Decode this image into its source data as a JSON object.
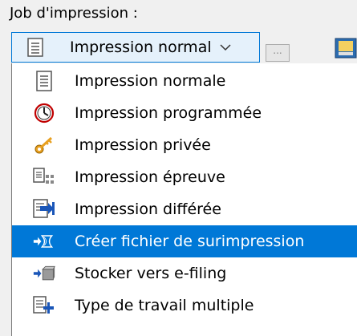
{
  "job_label": "Job d'impression :",
  "combo": {
    "selected": "Impression normal",
    "more_button": "..."
  },
  "options": [
    {
      "label": "Impression normale",
      "icon": "document-icon"
    },
    {
      "label": "Impression programmée",
      "icon": "clock-icon"
    },
    {
      "label": "Impression privée",
      "icon": "key-icon"
    },
    {
      "label": "Impression épreuve",
      "icon": "proof-icon"
    },
    {
      "label": "Impression différée",
      "icon": "hold-icon"
    },
    {
      "label": "Créer fichier de surimpression",
      "icon": "overlay-icon"
    },
    {
      "label": "Stocker vers e-filing",
      "icon": "efiling-icon"
    },
    {
      "label": "Type de travail multiple",
      "icon": "multiple-icon"
    }
  ],
  "selected_index": 5,
  "colors": {
    "highlight": "#0078d7",
    "combo_bg": "#e5f1fb",
    "clock_red": "#c00000",
    "key_orange": "#e8a020"
  }
}
